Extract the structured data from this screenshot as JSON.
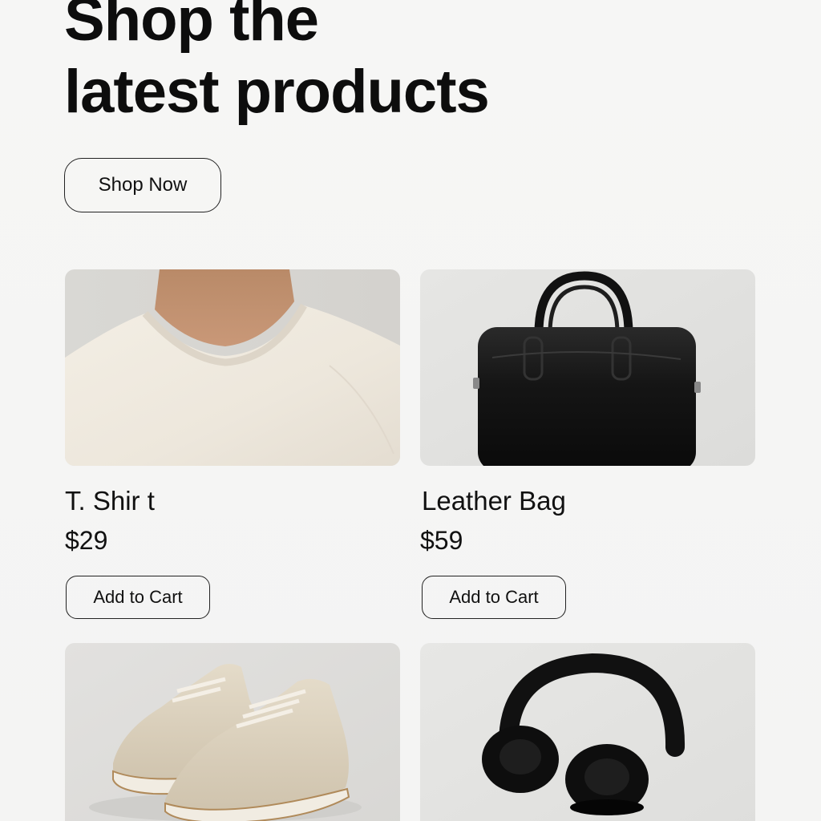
{
  "hero": {
    "title_line1": "Shop the",
    "title_line2": "latest products",
    "cta_label": "Shop Now"
  },
  "products": [
    {
      "name": "T. Shir t",
      "price": "$29",
      "button_label": "Add to Cart",
      "image": "t-shirt-photo"
    },
    {
      "name": "Leather Bag",
      "price": "$59",
      "button_label": "Add to Cart",
      "image": "leather-bag-photo"
    },
    {
      "name": "",
      "price": "",
      "button_label": "",
      "image": "sneakers-photo"
    },
    {
      "name": "",
      "price": "",
      "button_label": "",
      "image": "headphones-photo"
    }
  ]
}
